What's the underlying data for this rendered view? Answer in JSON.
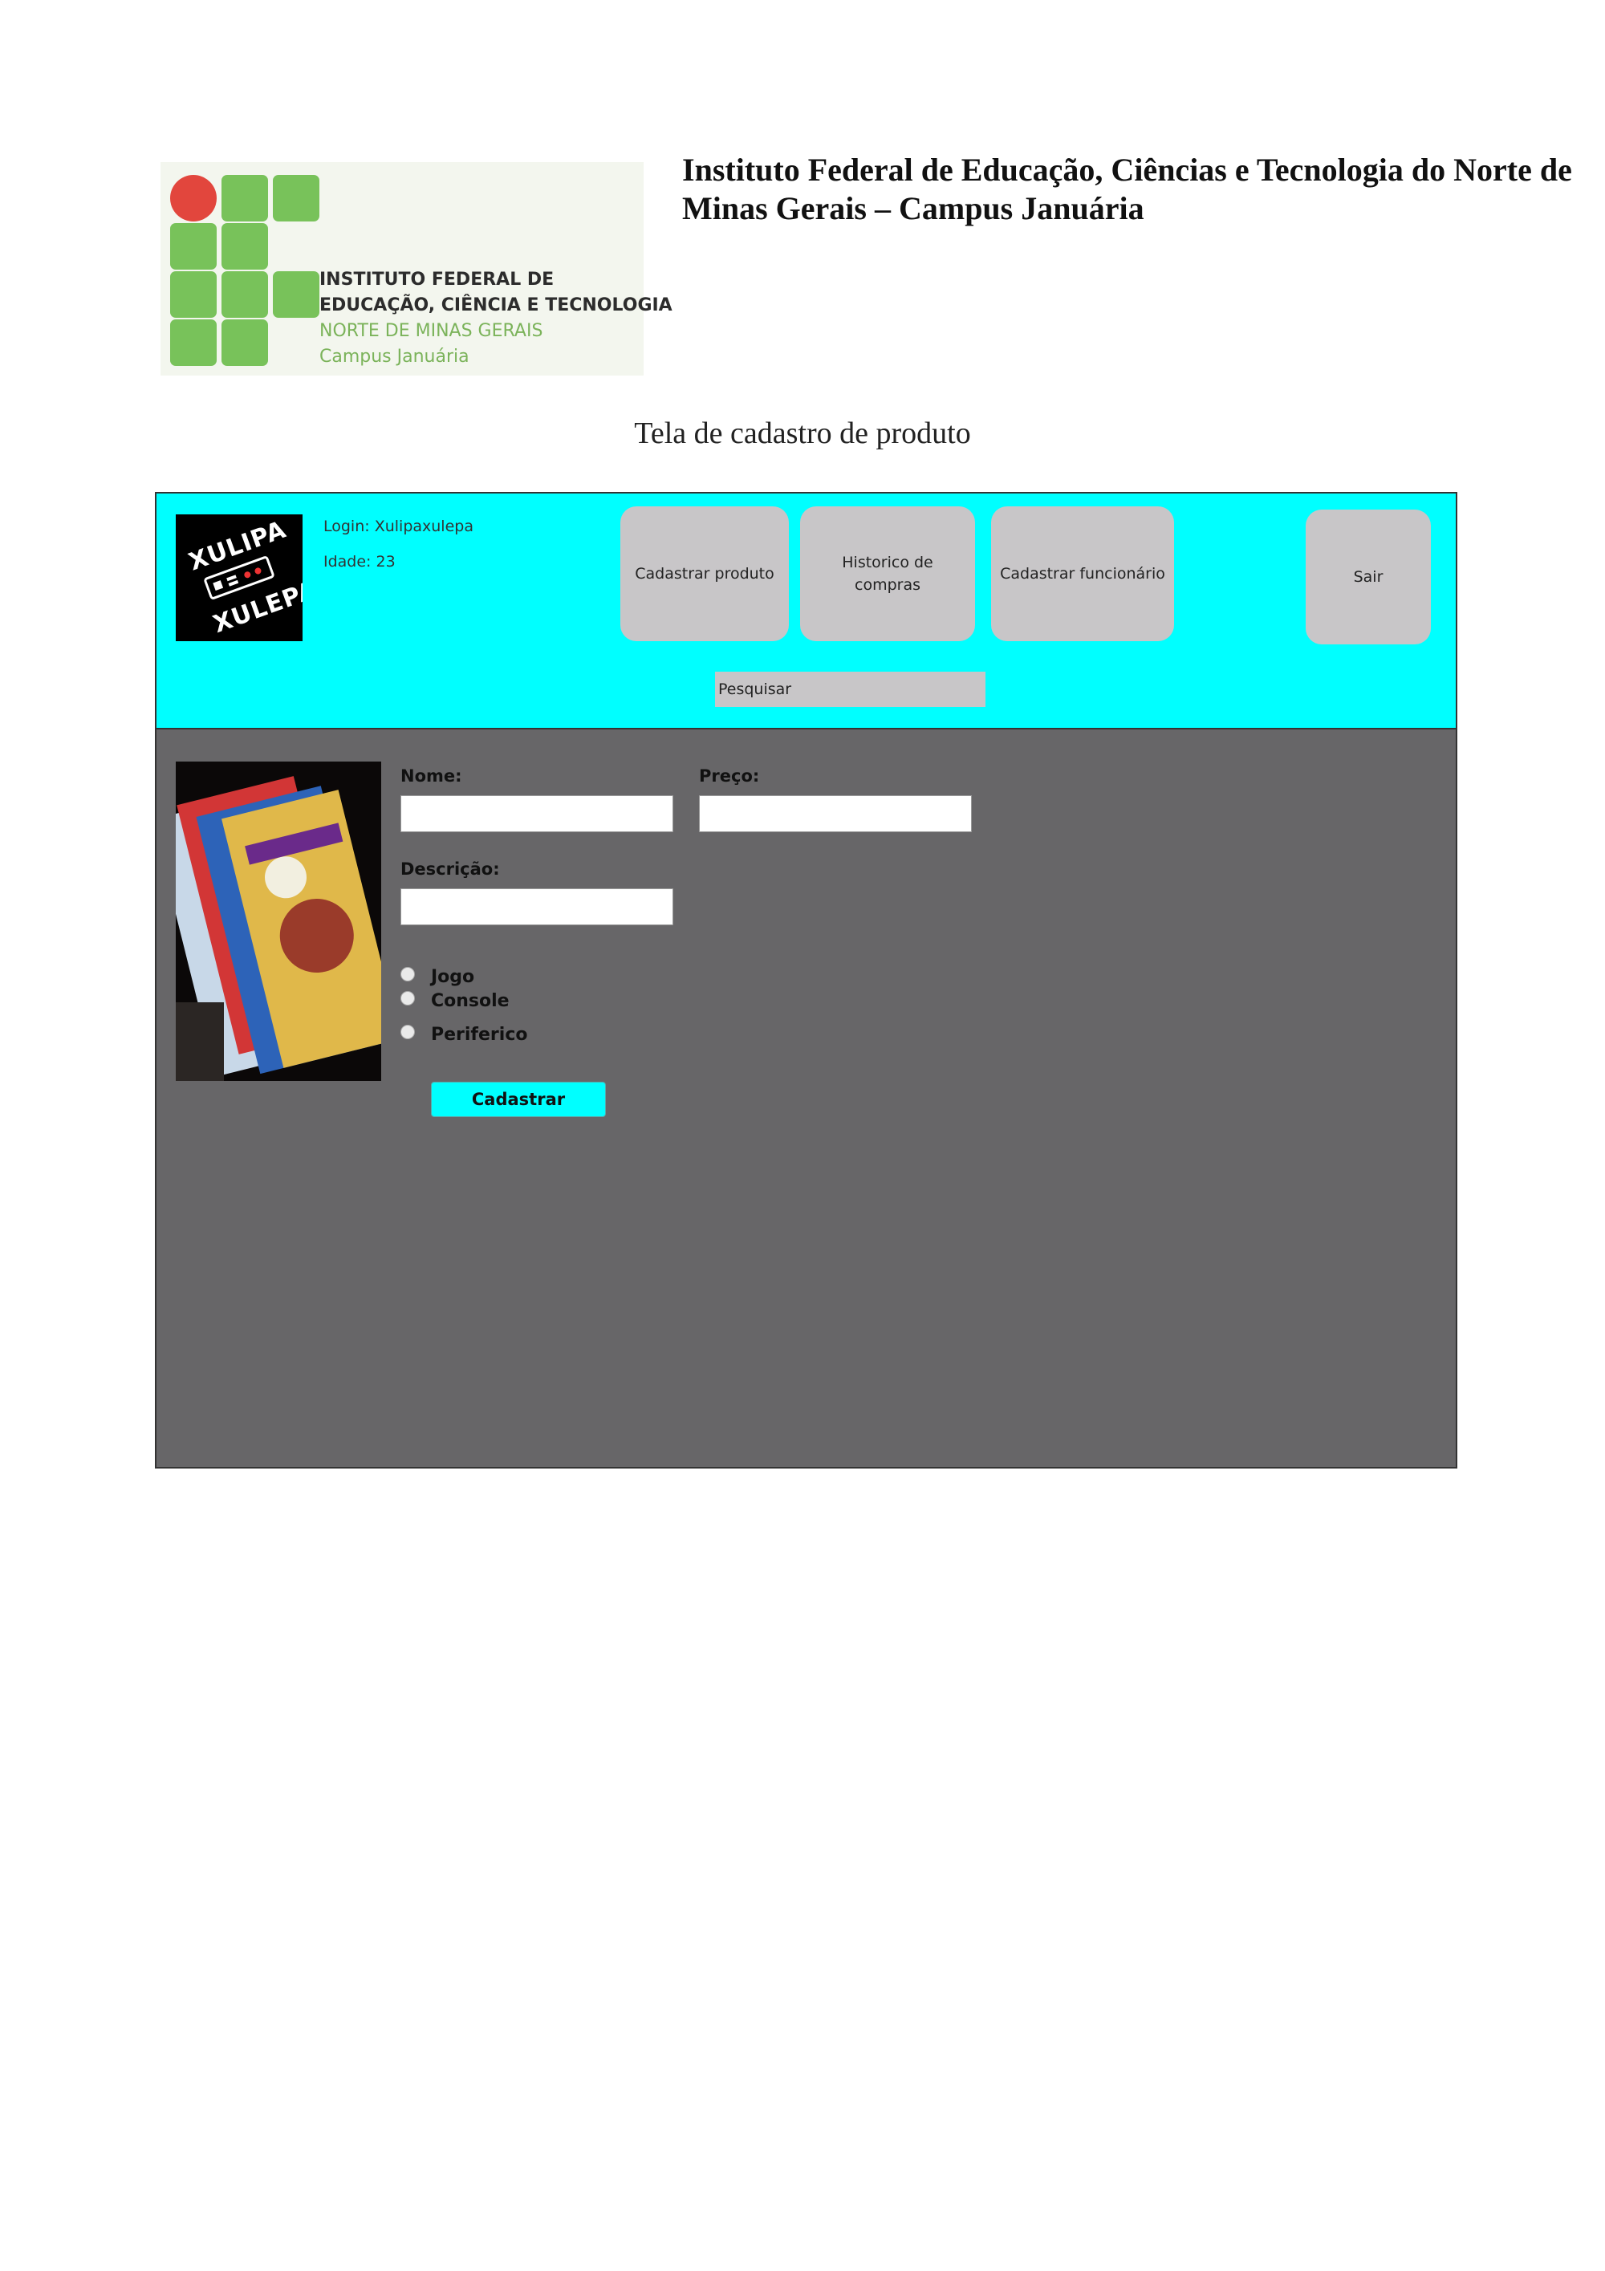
{
  "document": {
    "institution_title": "Instituto Federal de Educação, Ciências e Tecnologia do Norte de Minas Gerais – Campus Januária",
    "caption": "Tela de cadastro de produto",
    "logo": {
      "line1": "INSTITUTO FEDERAL DE",
      "line2": "EDUCAÇÃO, CIÊNCIA E TECNOLOGIA",
      "line3": "NORTE DE MINAS GERAIS",
      "line4": "Campus Januária"
    }
  },
  "app": {
    "brand": {
      "line1": "XULIPA",
      "line2": "XULEPA"
    },
    "user": {
      "login": "Login: Xulipaxulepa",
      "age": "Idade: 23"
    },
    "nav": {
      "register_product": "Cadastrar produto",
      "purchase_history_line1": "Historico de",
      "purchase_history_line2": "compras",
      "register_employee": "Cadastrar funcionário",
      "logout": "Sair"
    },
    "search": {
      "placeholder": "Pesquisar"
    },
    "form": {
      "name_label": "Nome:",
      "price_label": "Preço:",
      "description_label": "Descrição:",
      "type_options": [
        "Jogo",
        "Console",
        "Periferico"
      ],
      "submit_label": "Cadastrar"
    },
    "colors": {
      "header": "#00ffff",
      "body": "#676668",
      "button": "#c8c6c8",
      "submit": "#00ffff"
    }
  }
}
